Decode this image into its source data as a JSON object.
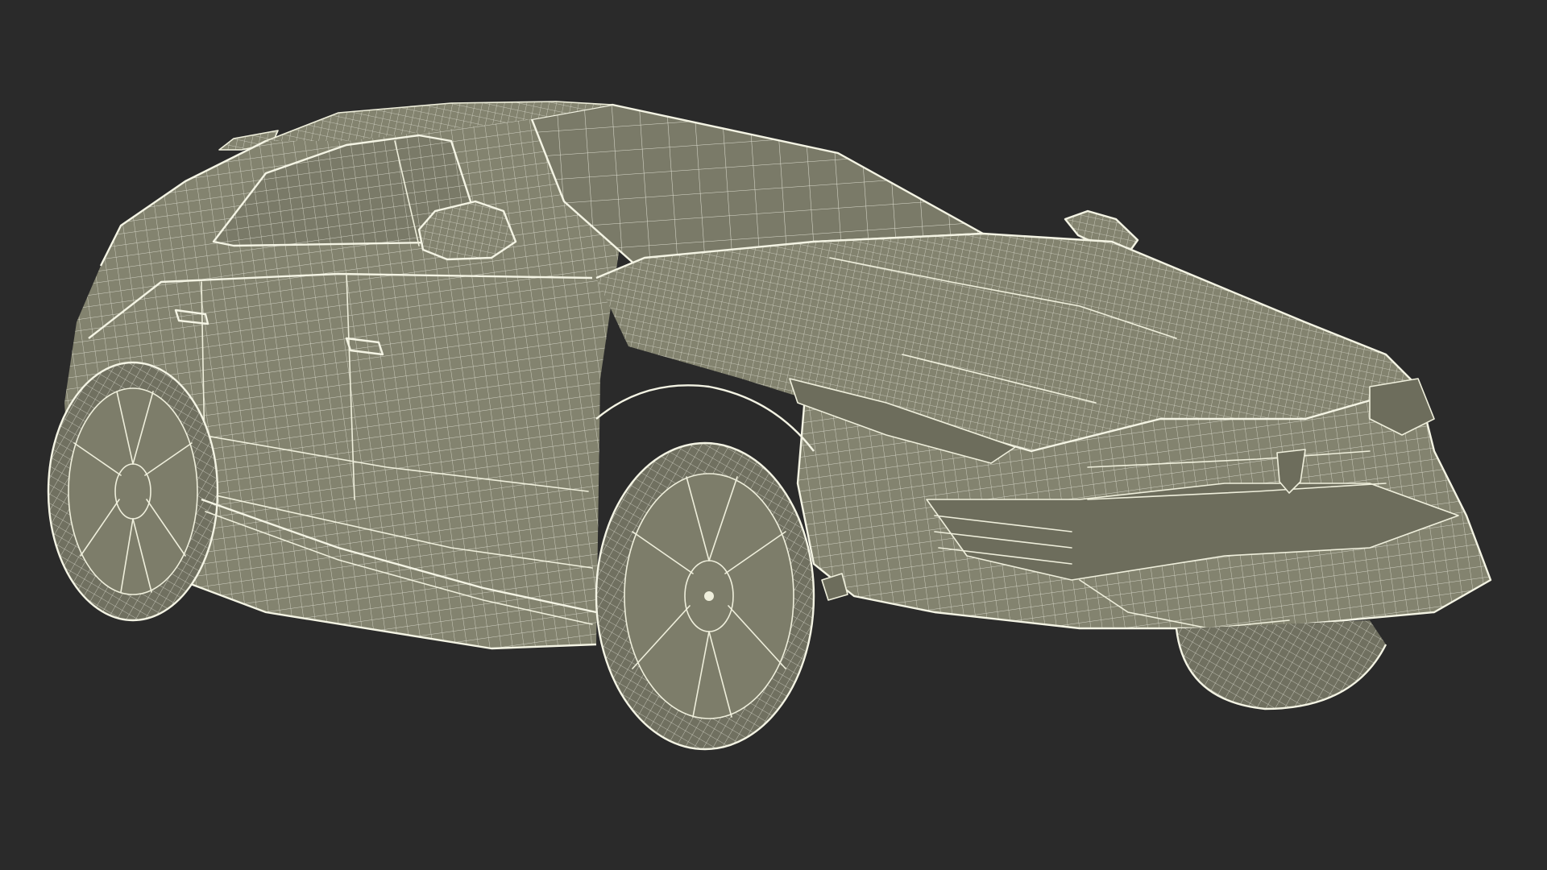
{
  "viewport": {
    "background_color": "#2a2a2a",
    "subject": "vehicle-wireframe-model",
    "wire_color": "#efefdc",
    "surface_color": "#83836f"
  }
}
